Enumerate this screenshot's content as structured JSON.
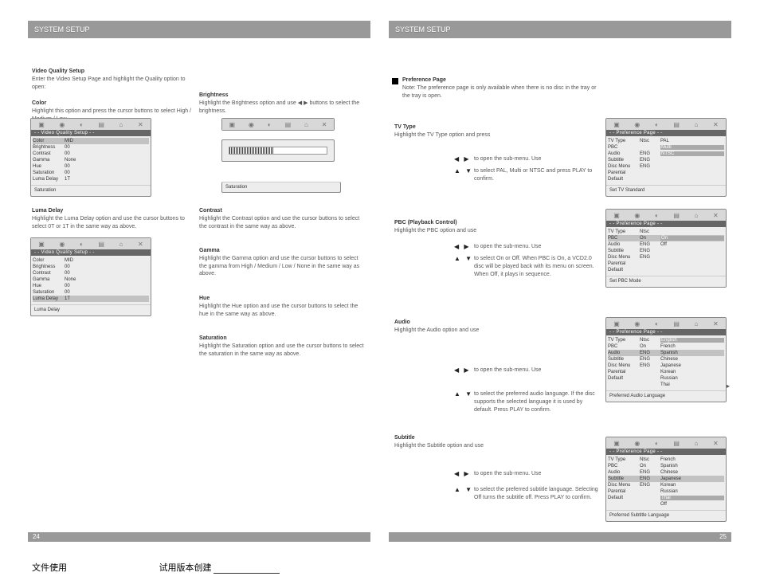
{
  "leftHeader": "SYSTEM SETUP",
  "rightHeader": "SYSTEM SETUP",
  "leftPageNum": "24",
  "rightPageNum": "25",
  "leftCol": {
    "videoQualityTitle": "- - Video Quality Setup - -",
    "menu1Rows": [
      {
        "label": "Color",
        "v1": "MID",
        "v2": "",
        "sel": true
      },
      {
        "label": "Brightness",
        "v1": "00",
        "v2": ""
      },
      {
        "label": "Contrast",
        "v1": "00",
        "v2": ""
      },
      {
        "label": "Gamma",
        "v1": "None",
        "v2": ""
      },
      {
        "label": "Hue",
        "v1": "00",
        "v2": ""
      },
      {
        "label": "Saturation",
        "v1": "00",
        "v2": ""
      },
      {
        "label": "Luma Delay",
        "v1": "1T",
        "v2": ""
      }
    ],
    "menu1Footer": "Saturation",
    "menu2Rows": [
      {
        "label": "Color",
        "v1": "MID",
        "v2": ""
      },
      {
        "label": "Brightness",
        "v1": "00",
        "v2": ""
      },
      {
        "label": "Contrast",
        "v1": "00",
        "v2": ""
      },
      {
        "label": "Gamma",
        "v1": "None",
        "v2": ""
      },
      {
        "label": "Hue",
        "v1": "00",
        "v2": ""
      },
      {
        "label": "Saturation",
        "v1": "00",
        "v2": ""
      },
      {
        "label": "Luma Delay",
        "v1": "1T",
        "v2": "",
        "sel": true,
        "hv2": true
      }
    ],
    "menu2Footer": "Luma Delay",
    "brightnessHead": "Brightness",
    "brightnessBody": "Highlight the Brightness option and use",
    "brightnessArrows": "◀  ▶",
    "brightnessBody2": "buttons to select the brightness.",
    "sliderFooter": "Saturation",
    "sliderIconsFooter": "",
    "contrastHead": "Contrast",
    "contrastBody": "Highlight the Contrast option and use the cursor buttons to select the contrast in the same way as above.",
    "gammaHead": "Gamma",
    "gammaBody": "Highlight the Gamma option and use the cursor buttons to select the gamma from High / Medium / Low / None in the same way as above.",
    "hueHead": "Hue",
    "hueBody": "Highlight the Hue option and use the cursor buttons to select the hue in the same way as above.",
    "satHead": "Saturation",
    "satBody": "Highlight the Saturation option and use the cursor buttons to select the saturation in the same way as above.",
    "lumaHead": "Luma Delay",
    "lumaBody": "Highlight the Luma Delay option and use the cursor buttons to select 0T or 1T in the same way as above."
  },
  "rightCol": {
    "prefTitle": "Preference Page",
    "prefIntro": "Note: The preference page is only available when there is no disc in the tray or the tray is open.",
    "prefMenuTitle": "- - Preference Page - -",
    "tvType": {
      "head": "TV Type",
      "body1": "Highlight the TV Type option and press",
      "body2": "to open the sub-menu. Use",
      "body3": "to select PAL, Multi or NTSC and press PLAY to confirm.",
      "rows": [
        {
          "label": "TV Type",
          "v1": "Ntsc",
          "v2": "PAL"
        },
        {
          "label": "PBC",
          "v1": "",
          "v2": "Multi",
          "hv2": true
        },
        {
          "label": "Audio",
          "v1": "ENG",
          "v2": "NTSC",
          "hv2": true
        },
        {
          "label": "Subtitle",
          "v1": "ENG",
          "v2": ""
        },
        {
          "label": "Disc Menu",
          "v1": "ENG",
          "v2": ""
        },
        {
          "label": "Parental",
          "v1": "",
          "v2": ""
        },
        {
          "label": "Default",
          "v1": "",
          "v2": ""
        }
      ],
      "footer": "Set TV Standard"
    },
    "pbc": {
      "head": "PBC (Playback Control)",
      "body1": "Highlight the PBC option and use",
      "body2": "to open the sub-menu. Use",
      "body3": "to select On or Off. When PBC is On, a VCD2.0 disc will be played back with its menu on screen. When Off, it plays in sequence.",
      "rows": [
        {
          "label": "TV Type",
          "v1": "Ntsc",
          "v2": ""
        },
        {
          "label": "PBC",
          "v1": "On",
          "v2": "On",
          "sel": true,
          "hv2": true
        },
        {
          "label": "Audio",
          "v1": "ENG",
          "v2": "Off"
        },
        {
          "label": "Subtitle",
          "v1": "ENG",
          "v2": ""
        },
        {
          "label": "Disc Menu",
          "v1": "ENG",
          "v2": ""
        },
        {
          "label": "Parental",
          "v1": "",
          "v2": ""
        },
        {
          "label": "Default",
          "v1": "",
          "v2": ""
        }
      ],
      "footer": "Set PBC Mode"
    },
    "audio": {
      "head": "Audio",
      "body1": "Highlight the Audio option and use",
      "body2": "to open the sub-menu. Use",
      "body3": "to select the preferred audio language. If the disc supports the selected language it is used by default. Press PLAY to confirm.",
      "rows": [
        {
          "label": "TV Type",
          "v1": "Ntsc",
          "v2": "English",
          "hv2": true
        },
        {
          "label": "PBC",
          "v1": "On",
          "v2": "French"
        },
        {
          "label": "Audio",
          "v1": "ENG",
          "v2": "Spanish",
          "sel": true
        },
        {
          "label": "Subtitle",
          "v1": "ENG",
          "v2": "Chinese"
        },
        {
          "label": "Disc Menu",
          "v1": "ENG",
          "v2": "Japanese"
        },
        {
          "label": "Parental",
          "v1": "",
          "v2": "Korean"
        },
        {
          "label": "Default",
          "v1": "",
          "v2": "Russian"
        }
      ],
      "extraRow": {
        "label": "",
        "v1": "",
        "v2": "Thai"
      },
      "footer": "Preferred Audio Language"
    },
    "subtitle": {
      "head": "Subtitle",
      "body1": "Highlight the Subtitle option and use",
      "body2": "to open the sub-menu. Use",
      "body3": "to select the preferred subtitle language. Selecting Off turns the subtitle off. Press PLAY to confirm.",
      "rows": [
        {
          "label": "TV Type",
          "v1": "Ntsc",
          "v2": "French"
        },
        {
          "label": "PBC",
          "v1": "On",
          "v2": "Spanish"
        },
        {
          "label": "Audio",
          "v1": "ENG",
          "v2": "Chinese"
        },
        {
          "label": "Subtitle",
          "v1": "ENG",
          "v2": "Japanese",
          "sel": true
        },
        {
          "label": "Disc Menu",
          "v1": "ENG",
          "v2": "Korean"
        },
        {
          "label": "Parental",
          "v1": "",
          "v2": "Russian"
        },
        {
          "label": "Default",
          "v1": "",
          "v2": "Thai",
          "hv2": true
        }
      ],
      "extraRow": {
        "label": "",
        "v1": "",
        "v2": "Off"
      },
      "footer": "Preferred Subtitle Language"
    }
  },
  "footerLeft": "文件使用",
  "footerRight": "试用版本创建"
}
